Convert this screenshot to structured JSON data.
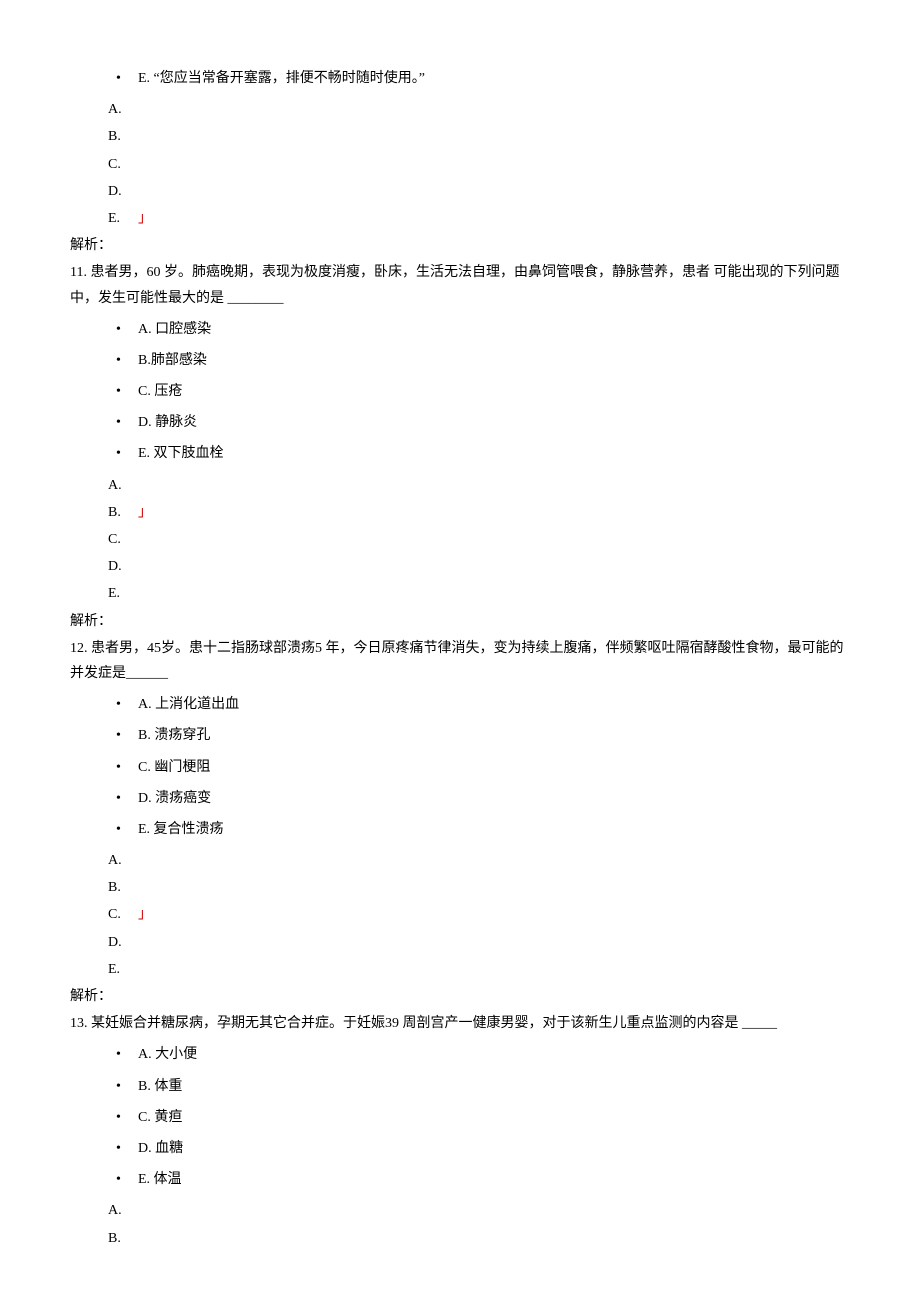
{
  "q10_optE": "E. “您应当常备开塞露，排便不畅时随时使用。”",
  "q10_ans": [
    "A.",
    "B.",
    "C.",
    "D.",
    "E."
  ],
  "q10_correct_idx": 4,
  "analysis_label": "解析：",
  "q11_stem": "11. 患者男，60 岁。肺癌晚期，表现为极度消瘦，卧床，生活无法自理，由鼻饲管喂食，静脉营养，患者 可能出现的下列问题中，发生可能性最大的是 ________",
  "q11_opts": [
    "A. 口腔感染",
    "B.肺部感染",
    "C. 压疮",
    "D. 静脉炎",
    "E. 双下肢血栓"
  ],
  "q11_ans": [
    "A.",
    "B.",
    "C.",
    "D.",
    "E."
  ],
  "q11_correct_idx": 1,
  "q12_stem": "12. 患者男，45岁。患十二指肠球部溃疡5 年，今日原疼痛节律消失，变为持续上腹痛，伴频繁呕吐隔宿酵酸性食物，最可能的并发症是______",
  "q12_opts": [
    "A. 上消化道出血",
    "B. 溃疡穿孔",
    "C. 幽门梗阻",
    "D. 溃疡癌变",
    "E. 复合性溃疡"
  ],
  "q12_ans": [
    "A.",
    "B.",
    "C.",
    "D.",
    "E."
  ],
  "q12_correct_idx": 2,
  "q13_stem": "13. 某妊娠合并糖尿病，孕期无其它合并症。于妊娠39 周剖宫产一健康男婴，对于该新生儿重点监测的内容是 _____",
  "q13_opts": [
    "A. 大小便",
    "B. 体重",
    "C. 黄疸",
    "D. 血糖",
    "E. 体温"
  ],
  "q13_ans": [
    "A.",
    "B."
  ],
  "mark_glyph": "」"
}
